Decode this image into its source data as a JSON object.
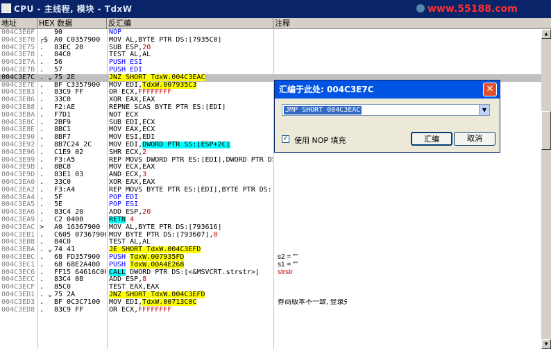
{
  "window": {
    "title": "CPU - 主线程, 模块 - TdxW",
    "watermark": "www.55188.com"
  },
  "columns": {
    "addr": "地址",
    "hex": "HEX 数据",
    "asm": "反汇编",
    "comment": "注释"
  },
  "rows": [
    {
      "addr": "004C3E6F",
      "mk": "",
      "hex": "90",
      "asm": [
        {
          "t": "NOP",
          "c": "p"
        }
      ]
    },
    {
      "addr": "004C3E70",
      "mk": "┌$",
      "hex": "A0 C0357900",
      "asm": [
        {
          "t": "MOV AL,BYTE PTR DS:[7935C0]"
        }
      ]
    },
    {
      "addr": "004C3E75",
      "mk": ".",
      "hex": "83EC 20",
      "asm": [
        {
          "t": "SUB ESP,"
        },
        {
          "t": "20",
          "c": "r"
        }
      ]
    },
    {
      "addr": "004C3E78",
      "mk": ".",
      "hex": "84C0",
      "asm": [
        {
          "t": "TEST AL,AL"
        }
      ]
    },
    {
      "addr": "004C3E7A",
      "mk": ".",
      "hex": "56",
      "asm": [
        {
          "t": "PUSH ESI",
          "c": "p"
        }
      ]
    },
    {
      "addr": "004C3E7B",
      "mk": ".",
      "hex": "57",
      "asm": [
        {
          "t": "PUSH EDI",
          "c": "p"
        }
      ]
    },
    {
      "addr": "004C3E7C",
      "mk": ". ⌄",
      "hex": "75 2E",
      "sel": true,
      "asm": [
        {
          "t": "JNZ SHORT TdxW.004C3EAC",
          "c": "y"
        }
      ]
    },
    {
      "addr": "004C3E7E",
      "mk": ".",
      "hex": "BF C3357900",
      "asm": [
        {
          "t": "MOV EDI,"
        },
        {
          "t": "TdxW.007935C3",
          "c": "y"
        }
      ]
    },
    {
      "addr": "004C3E83",
      "mk": ".",
      "hex": "83C9 FF",
      "asm": [
        {
          "t": "OR ECX,"
        },
        {
          "t": "FFFFFFFF",
          "c": "r"
        }
      ]
    },
    {
      "addr": "004C3E86",
      "mk": ".",
      "hex": "33C0",
      "asm": [
        {
          "t": "XOR EAX,EAX"
        }
      ]
    },
    {
      "addr": "004C3E88",
      "mk": ".",
      "hex": "F2:AE",
      "asm": [
        {
          "t": "REPNE SCAS BYTE PTR ES:[EDI]"
        }
      ]
    },
    {
      "addr": "004C3E8A",
      "mk": ".",
      "hex": "F7D1",
      "asm": [
        {
          "t": "NOT ECX"
        }
      ]
    },
    {
      "addr": "004C3E8C",
      "mk": ".",
      "hex": "2BF9",
      "asm": [
        {
          "t": "SUB EDI,ECX"
        }
      ]
    },
    {
      "addr": "004C3E8E",
      "mk": ".",
      "hex": "8BC1",
      "asm": [
        {
          "t": "MOV EAX,ECX"
        }
      ]
    },
    {
      "addr": "004C3E90",
      "mk": ".",
      "hex": "8BF7",
      "asm": [
        {
          "t": "MOV ESI,EDI"
        }
      ]
    },
    {
      "addr": "004C3E92",
      "mk": ".",
      "hex": "8B7C24 2C",
      "asm": [
        {
          "t": "MOV EDI,"
        },
        {
          "t": "DWORD PTR SS:[ESP+2C]",
          "c": "c"
        }
      ]
    },
    {
      "addr": "004C3E96",
      "mk": ".",
      "hex": "C1E9 02",
      "asm": [
        {
          "t": "SHR ECX,"
        },
        {
          "t": "2",
          "c": "r"
        }
      ]
    },
    {
      "addr": "004C3E99",
      "mk": ".",
      "hex": "F3:A5",
      "asm": [
        {
          "t": "REP MOVS DWORD PTR ES:[EDI],DWORD PTR DS"
        }
      ]
    },
    {
      "addr": "004C3E9B",
      "mk": ".",
      "hex": "8BC8",
      "asm": [
        {
          "t": "MOV ECX,EAX"
        }
      ]
    },
    {
      "addr": "004C3E9D",
      "mk": ".",
      "hex": "83E1 03",
      "asm": [
        {
          "t": "AND ECX,"
        },
        {
          "t": "3",
          "c": "r"
        }
      ]
    },
    {
      "addr": "004C3EA0",
      "mk": ".",
      "hex": "33C0",
      "asm": [
        {
          "t": "XOR EAX,EAX"
        }
      ]
    },
    {
      "addr": "004C3EA2",
      "mk": ".",
      "hex": "F3:A4",
      "asm": [
        {
          "t": "REP MOVS BYTE PTR ES:[EDI],BYTE PTR DS:"
        }
      ]
    },
    {
      "addr": "004C3EA4",
      "mk": ".",
      "hex": "5F",
      "asm": [
        {
          "t": "POP EDI",
          "c": "p"
        }
      ]
    },
    {
      "addr": "004C3EA5",
      "mk": ".",
      "hex": "5E",
      "asm": [
        {
          "t": "POP ESI",
          "c": "p"
        }
      ]
    },
    {
      "addr": "004C3EA6",
      "mk": ".",
      "hex": "83C4 20",
      "asm": [
        {
          "t": "ADD ESP,"
        },
        {
          "t": "20",
          "c": "r"
        }
      ]
    },
    {
      "addr": "004C3EA9",
      "mk": ".",
      "hex": "C2 0400",
      "asm": [
        {
          "t": "RETN",
          "c": "c"
        },
        {
          "t": " 4",
          "c": "r"
        }
      ]
    },
    {
      "addr": "004C3EAC",
      "mk": "> ",
      "hex": "A0 16367900",
      "asm": [
        {
          "t": "MOV AL,BYTE PTR DS:[793616]"
        }
      ]
    },
    {
      "addr": "004C3EB1",
      "mk": ".",
      "hex": "C605 07367900",
      "asm": [
        {
          "t": "MOV BYTE PTR DS:[793607],"
        },
        {
          "t": "0",
          "c": "r"
        }
      ]
    },
    {
      "addr": "004C3EB8",
      "mk": ".",
      "hex": "84C0",
      "asm": [
        {
          "t": "TEST AL,AL"
        }
      ]
    },
    {
      "addr": "004C3EBA",
      "mk": ". ⌄",
      "hex": "74 41",
      "asm": [
        {
          "t": "JE SHORT TdxW.004C3EFD",
          "c": "y"
        }
      ]
    },
    {
      "addr": "004C3EBC",
      "mk": ".",
      "hex": "68 FD357900",
      "asm": [
        {
          "t": "PUSH ",
          "c": "p"
        },
        {
          "t": "TdxW.007935FD",
          "c": "y"
        }
      ],
      "cm": [
        {
          "t": "s2 = \"\""
        }
      ]
    },
    {
      "addr": "004C3EC1",
      "mk": ".",
      "hex": "68 68E2A400",
      "asm": [
        {
          "t": "PUSH ",
          "c": "p"
        },
        {
          "t": "TdxW.00A4E268",
          "c": "y"
        }
      ],
      "cm": [
        {
          "t": "s1 = \"\""
        }
      ]
    },
    {
      "addr": "004C3EC6",
      "mk": ".",
      "hex": "FF15 64616C00",
      "asm": [
        {
          "t": "CALL",
          "c": "c"
        },
        {
          "t": " DWORD PTR DS:[<&MSVCRT.strstr>]"
        }
      ],
      "cm": [
        {
          "t": "strstr",
          "c": "r"
        }
      ]
    },
    {
      "addr": "004C3ECC",
      "mk": ".",
      "hex": "83C4 08",
      "asm": [
        {
          "t": "ADD ESP,"
        },
        {
          "t": "8",
          "c": "r"
        }
      ]
    },
    {
      "addr": "004C3ECF",
      "mk": ".",
      "hex": "85C0",
      "asm": [
        {
          "t": "TEST EAX,EAX"
        }
      ]
    },
    {
      "addr": "004C3ED1",
      "mk": ". ⌄",
      "hex": "75 2A",
      "asm": [
        {
          "t": "JNZ SHORT TdxW.004C3EFD",
          "c": "y"
        }
      ]
    },
    {
      "addr": "004C3ED3",
      "mk": ".",
      "hex": "BF 0C3C7100",
      "asm": [
        {
          "t": "MOV EDI,"
        },
        {
          "t": "TdxW.00713C0C",
          "c": "y"
        }
      ],
      "cm": [
        {
          "t": "券商版本不一致, 登录失败"
        }
      ]
    },
    {
      "addr": "004C3ED8",
      "mk": ".",
      "hex": "83C9 FF",
      "asm": [
        {
          "t": "OR ECX,"
        },
        {
          "t": "FFFFFFFF",
          "c": "r"
        }
      ]
    }
  ],
  "dialog": {
    "title": "汇编于此处: 004C3E7C",
    "input_value": "JMP SHORT 004C3EAC",
    "checkbox_label": "使用 NOP 填充",
    "checkbox_checked": true,
    "assemble_label": "汇编",
    "cancel_label": "取消",
    "close_glyph": "✕",
    "check_glyph": "✓",
    "dropdown_glyph": "▼"
  },
  "scrollbar": {
    "up_glyph": "▲",
    "down_glyph": "▼"
  }
}
